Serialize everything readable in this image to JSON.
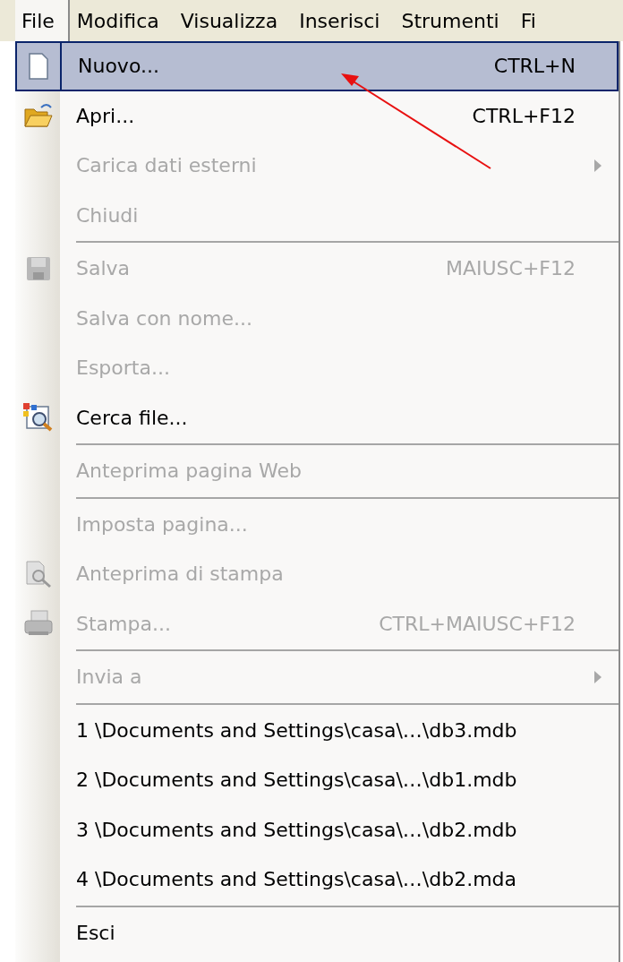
{
  "menu_bar": [
    {
      "label": "File",
      "selected": true
    },
    {
      "label": "Modifica",
      "selected": false
    },
    {
      "label": "Visualizza",
      "selected": false
    },
    {
      "label": "Inserisci",
      "selected": false
    },
    {
      "label": "Strumenti",
      "selected": false
    },
    {
      "label": "Fi",
      "selected": false
    }
  ],
  "file_menu": [
    {
      "kind": "item",
      "label": "Nuovo...",
      "shortcut": "CTRL+N",
      "disabled": false,
      "selected": true
    },
    {
      "kind": "item",
      "label": "Apri...",
      "shortcut": "CTRL+F12",
      "disabled": false,
      "selected": false
    },
    {
      "kind": "item",
      "label": "Carica dati esterni",
      "disabled": true,
      "selected": false,
      "submenu": true
    },
    {
      "kind": "item",
      "label": "Chiudi",
      "disabled": true,
      "selected": false
    },
    {
      "kind": "separator"
    },
    {
      "kind": "item",
      "label": "Salva",
      "shortcut": "MAIUSC+F12",
      "disabled": true,
      "selected": false
    },
    {
      "kind": "item",
      "label": "Salva con nome...",
      "disabled": true,
      "selected": false
    },
    {
      "kind": "item",
      "label": "Esporta...",
      "disabled": true,
      "selected": false
    },
    {
      "kind": "item",
      "label": "Cerca file...",
      "disabled": false,
      "selected": false
    },
    {
      "kind": "separator"
    },
    {
      "kind": "item",
      "label": "Anteprima pagina Web",
      "disabled": true,
      "selected": false
    },
    {
      "kind": "separator"
    },
    {
      "kind": "item",
      "label": "Imposta pagina...",
      "disabled": true,
      "selected": false
    },
    {
      "kind": "item",
      "label": "Anteprima di stampa",
      "disabled": true,
      "selected": false
    },
    {
      "kind": "item",
      "label": "Stampa...",
      "shortcut": "CTRL+MAIUSC+F12",
      "disabled": true,
      "selected": false
    },
    {
      "kind": "separator"
    },
    {
      "kind": "item",
      "label": "Invia a",
      "disabled": true,
      "selected": false,
      "submenu": true
    },
    {
      "kind": "separator"
    },
    {
      "kind": "item",
      "label": "1 \\Documents and Settings\\casa\\…\\db3.mdb",
      "disabled": false,
      "selected": false
    },
    {
      "kind": "item",
      "label": "2 \\Documents and Settings\\casa\\…\\db1.mdb",
      "disabled": false,
      "selected": false
    },
    {
      "kind": "item",
      "label": "3 \\Documents and Settings\\casa\\…\\db2.mdb",
      "disabled": false,
      "selected": false
    },
    {
      "kind": "item",
      "label": "4 \\Documents and Settings\\casa\\…\\db2.mda",
      "disabled": false,
      "selected": false
    },
    {
      "kind": "separator"
    },
    {
      "kind": "item",
      "label": "Esci",
      "disabled": false,
      "selected": false
    }
  ]
}
